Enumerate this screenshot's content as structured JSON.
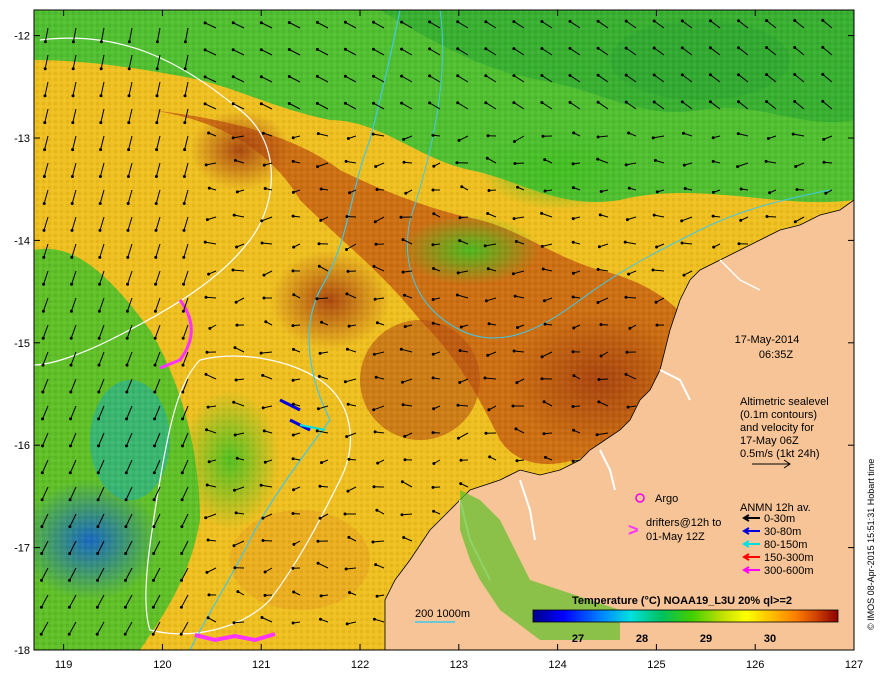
{
  "map": {
    "lon_min": 118.7,
    "lon_max": 127,
    "lat_top": -11.75,
    "lat_bottom": -18,
    "lon_ticks": [
      "119",
      "120",
      "121",
      "122",
      "123",
      "124",
      "125",
      "126",
      "127"
    ],
    "lat_ticks": [
      "-12",
      "-13",
      "-14",
      "-15",
      "-16",
      "-17",
      "-18"
    ],
    "land_color": "#f6c496"
  },
  "annotations": {
    "date": "17-May-2014",
    "time": "06:35Z",
    "altimetric": [
      "Altimetric sealevel",
      "(0.1m contours)",
      "and velocity for",
      "17-May 06Z",
      "0.5m/s (1kt 24h)"
    ],
    "argo_label": "Argo",
    "drifters": [
      "drifters@12h to",
      "01-May 12Z"
    ],
    "anmn_title": "ANMN 12h av.",
    "anmn_items": [
      {
        "label": "0-30m",
        "color": "#000000"
      },
      {
        "label": "30-80m",
        "color": "#0000dd"
      },
      {
        "label": "80-150m",
        "color": "#00e0e0"
      },
      {
        "label": "150-300m",
        "color": "#ff0000"
      },
      {
        "label": "300-600m",
        "color": "#ff00ff"
      }
    ],
    "isobath": "200  1000m",
    "isobath_color": "#40c8e8",
    "argo_color": "#ee00ee",
    "drifter_color": "#ff33ff"
  },
  "colorbar": {
    "title": "Temperature (°C) NOAA19_L3U 20% ql>=2",
    "ticks": [
      "27",
      "28",
      "29",
      "30"
    ]
  },
  "credit": "© IMOS 08-Apr-2015 15:51:31 Hobart time"
}
